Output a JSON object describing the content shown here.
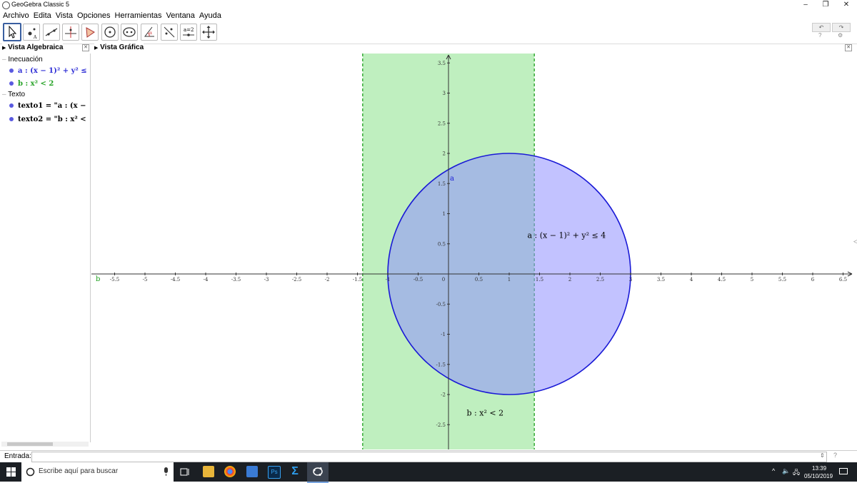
{
  "window": {
    "title": "GeoGebra Classic 5",
    "minimize": "–",
    "restore": "❐",
    "close": "✕"
  },
  "menu": [
    "Archivo",
    "Edita",
    "Vista",
    "Opciones",
    "Herramientas",
    "Ventana",
    "Ayuda"
  ],
  "tools": [
    "move-tool",
    "point-tool",
    "line-tool",
    "perpendicular-tool",
    "polygon-tool",
    "circle-tool",
    "conic-tool",
    "angle-tool",
    "reflect-tool",
    "slider-tool",
    "move-view-tool"
  ],
  "toolbar_right": {
    "undo": "↶",
    "redo": "↷",
    "help": "?",
    "settings": "⚙"
  },
  "algebra_view": {
    "title": "Vista Algebraica",
    "groups": [
      {
        "label": "Inecuación",
        "items": [
          {
            "name": "a :",
            "expr": "(x − 1)² + y² ≤",
            "color": "#2f2fd6"
          },
          {
            "name": "b :",
            "expr": "x² < 2",
            "color": "#27a327"
          }
        ]
      },
      {
        "label": "Texto",
        "items": [
          {
            "name": "texto1",
            "expr": "= \"a : (x −",
            "color": "#000000"
          },
          {
            "name": "texto2",
            "expr": "= \"b : x² <",
            "color": "#000000"
          }
        ]
      }
    ]
  },
  "graphics_view": {
    "title": "Vista Gráfica",
    "circle_label": "a",
    "strip_label": "b",
    "text_a": "a :  (x − 1)² + y² ≤ 4",
    "text_b": "b :  x² < 2",
    "colors": {
      "circle_fill": "#8f8fff",
      "circle_stroke": "#1a1ad6",
      "strip_fill": "#7fe07f",
      "strip_stroke": "#1ea01e"
    }
  },
  "chart_data": {
    "type": "scatter",
    "xlim": [
      -5.5,
      6.5
    ],
    "ylim": [
      -2.5,
      3.5
    ],
    "x_ticks": [
      "-5.5",
      "-5",
      "-4.5",
      "-4",
      "-3.5",
      "-3",
      "-2.5",
      "-2",
      "-1.5",
      "-1",
      "-0.5",
      "0",
      "0.5",
      "1",
      "1.5",
      "2",
      "2.5",
      "3",
      "3.5",
      "4",
      "4.5",
      "5",
      "5.5",
      "6",
      "6.5"
    ],
    "y_ticks": [
      "3.5",
      "3",
      "2.5",
      "2",
      "1.5",
      "1",
      "0.5",
      "-0.5",
      "-1",
      "-1.5",
      "-2",
      "-2.5"
    ],
    "regions": [
      {
        "name": "a",
        "inequality": "(x − 1)² + y² ≤ 4",
        "center": [
          1,
          0
        ],
        "radius": 2
      },
      {
        "name": "b",
        "inequality": "x² < 2",
        "x_from": -1.414,
        "x_to": 1.414
      }
    ]
  },
  "input_bar": {
    "label": "Entrada:",
    "value": "",
    "help": "?"
  },
  "taskbar": {
    "search_placeholder": "Escribe aquí para buscar",
    "time": "13:39",
    "date": "05/10/2019"
  }
}
